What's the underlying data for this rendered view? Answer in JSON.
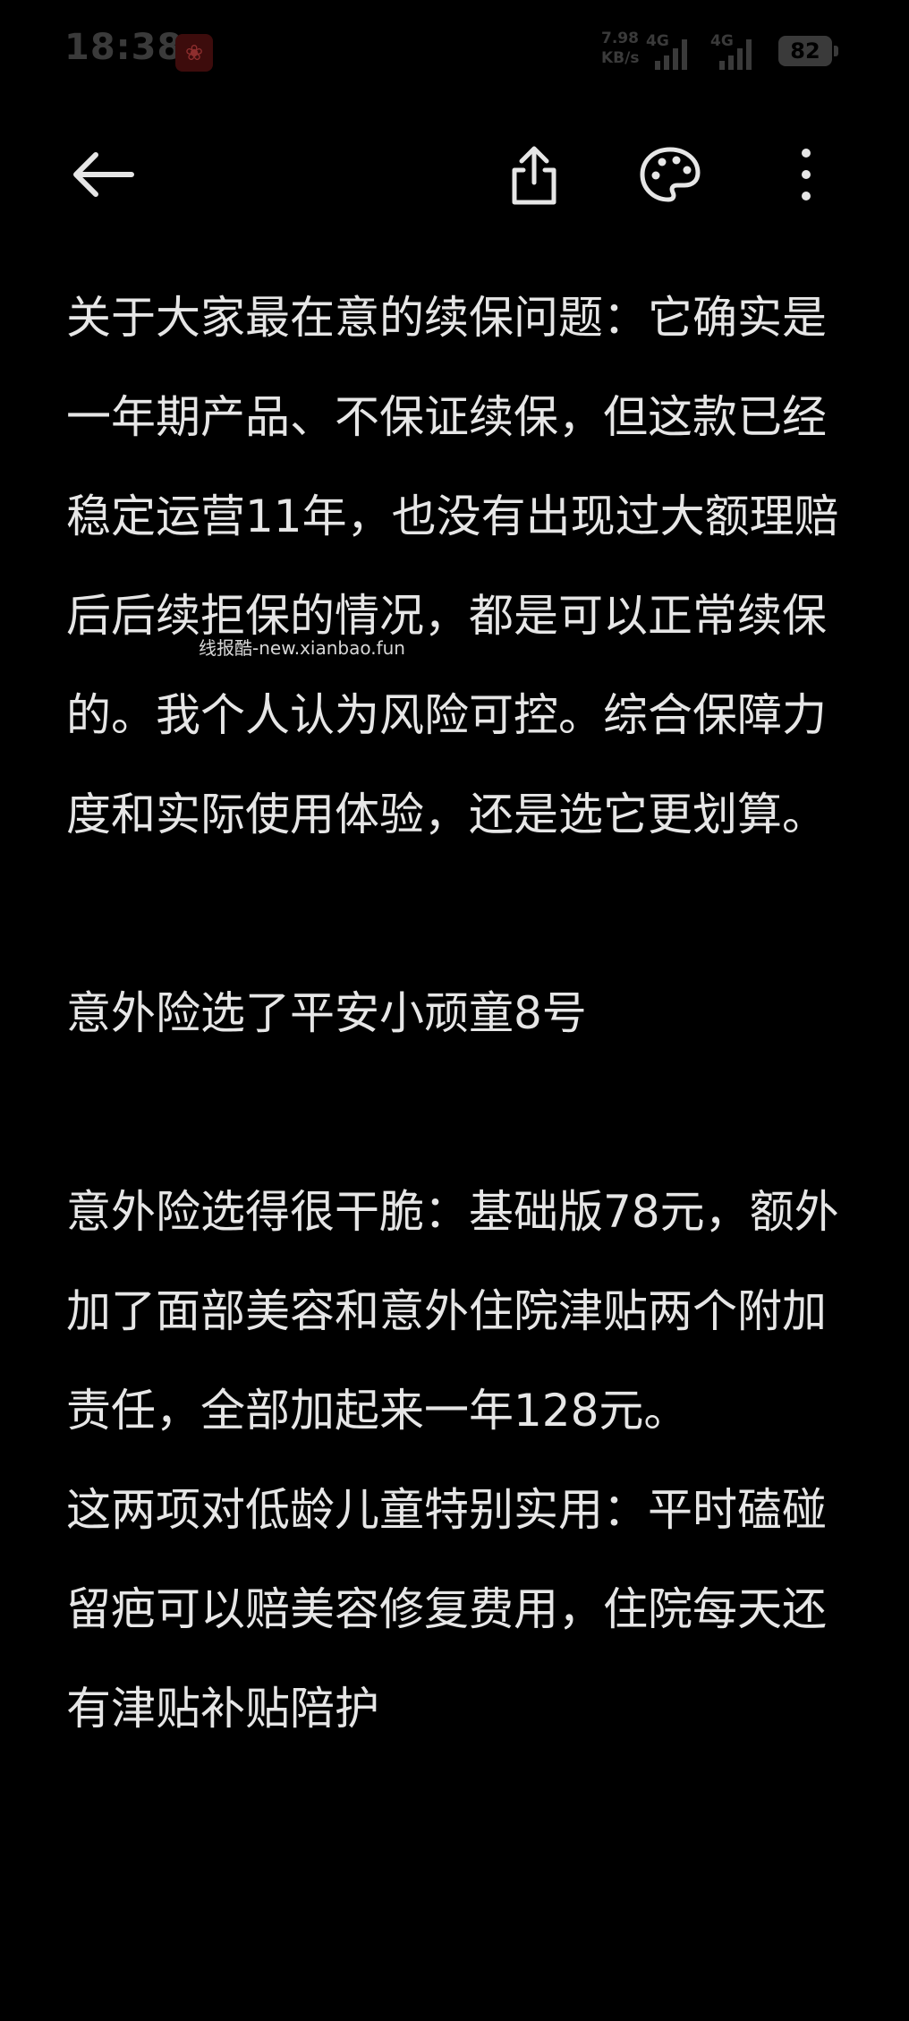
{
  "status_bar": {
    "time": "18:38",
    "app_badge_icon": "gift-icon",
    "net_speed_value": "7.98",
    "net_speed_unit": "KB/s",
    "signal_1_label": "4G",
    "signal_2_label": "4G",
    "battery_level": "82"
  },
  "toolbar": {
    "back_icon": "arrow-left-icon",
    "share_icon": "share-icon",
    "theme_icon": "palette-icon",
    "more_icon": "more-vertical-icon"
  },
  "article": {
    "paragraphs": [
      "关于大家最在意的续保问题：它确实是一年期产品、不保证续保，但这款已经稳定运营11年，也没有出现过大额理赔后后续拒保的情况，都是可以正常续保的。我个人认为风险可控。综合保障力度和实际使用体验，还是选它更划算。",
      "意外险选了平安小顽童8号",
      "意外险选得很干脆：基础版78元，额外加了面部美容和意外住院津贴两个附加责任，全部加起来一年128元。",
      "这两项对低龄儿童特别实用：平时磕碰留疤可以赔美容修复费用，住院每天还有津贴补贴陪护"
    ]
  },
  "watermark": "线报酷-new.xianbao.fun",
  "colors": {
    "background": "#000000",
    "text": "#e6e6e6",
    "status_text": "#3a3a3a"
  }
}
